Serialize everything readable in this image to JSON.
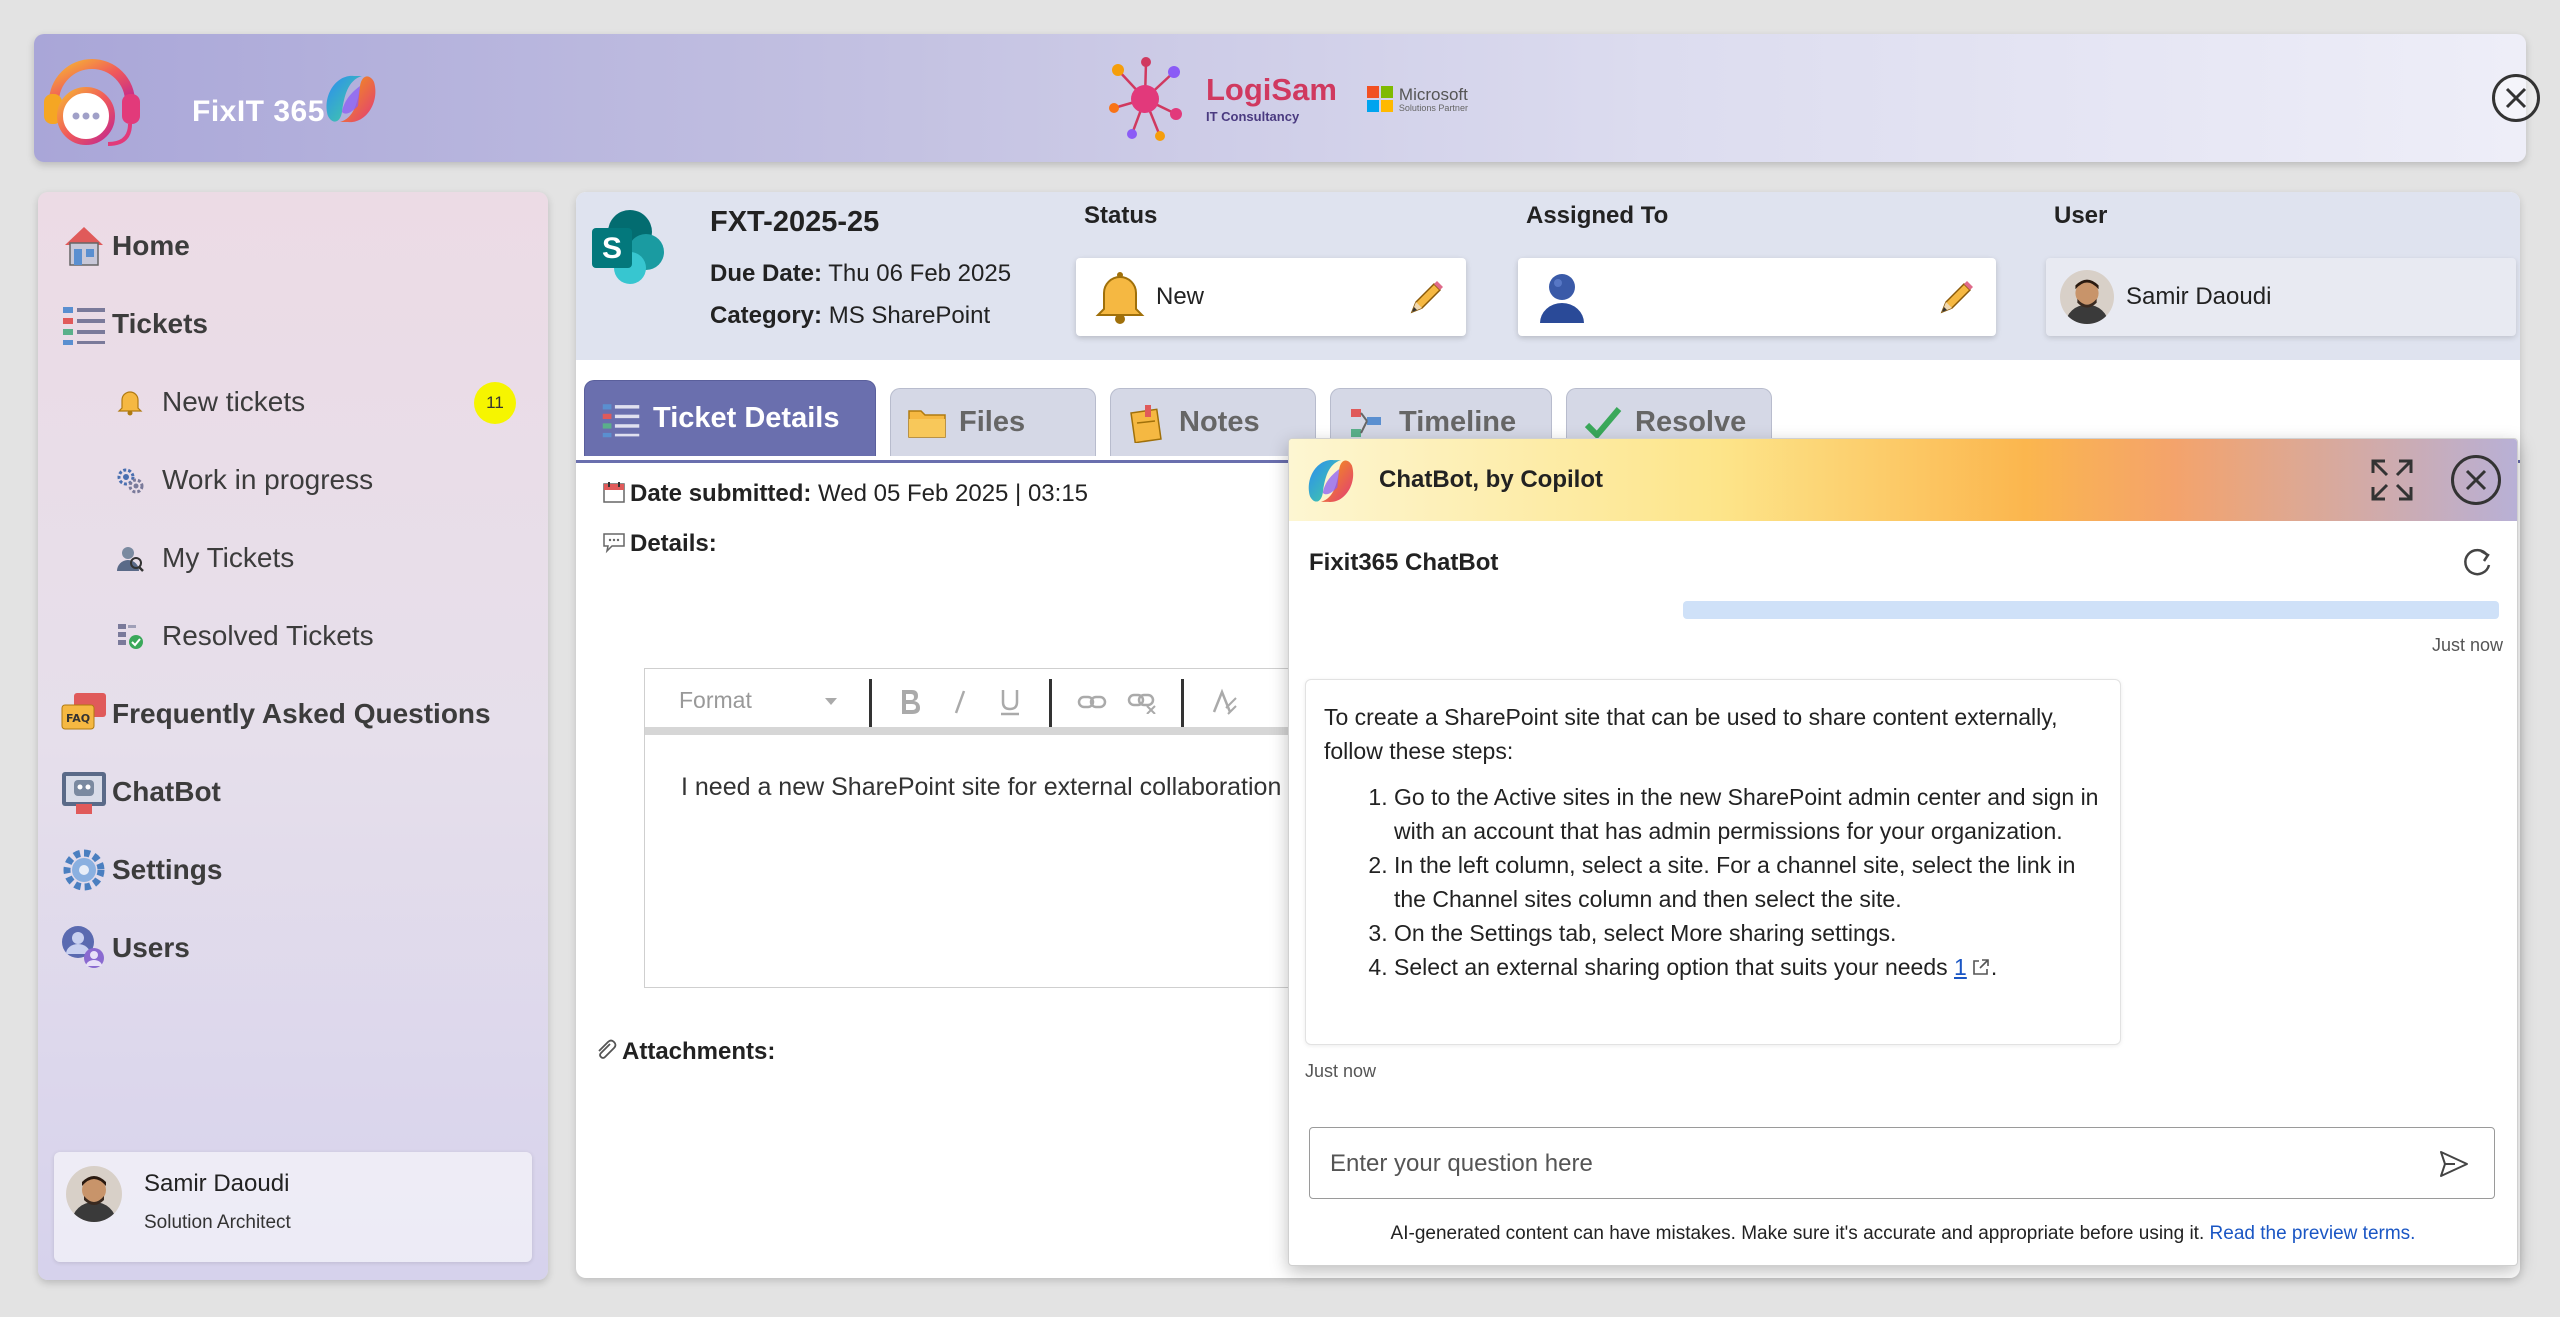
{
  "header": {
    "app_name": "FixIT 365",
    "partner_name": "LogiSam",
    "partner_sub": "IT Consultancy",
    "ms_line1": "Microsoft",
    "ms_line2": "Solutions Partner"
  },
  "sidebar": {
    "items": [
      {
        "label": "Home"
      },
      {
        "label": "Tickets"
      },
      {
        "label": "New tickets",
        "badge": "11"
      },
      {
        "label": "Work in progress"
      },
      {
        "label": "My Tickets"
      },
      {
        "label": "Resolved Tickets"
      },
      {
        "label": "Frequently Asked Questions"
      },
      {
        "label": "ChatBot"
      },
      {
        "label": "Settings"
      },
      {
        "label": "Users"
      }
    ],
    "user": {
      "name": "Samir Daoudi",
      "role": "Solution Architect"
    }
  },
  "ticket": {
    "id": "FXT-2025-25",
    "due_label": "Due Date:",
    "due_value": "Thu 06 Feb 2025",
    "category_label": "Category:",
    "category_value": "MS SharePoint",
    "status_label": "Status",
    "status_value": "New",
    "assigned_label": "Assigned To",
    "assigned_value": "",
    "user_label": "User",
    "user_value": "Samir Daoudi"
  },
  "tabs": [
    {
      "label": "Ticket Details"
    },
    {
      "label": "Files"
    },
    {
      "label": "Notes"
    },
    {
      "label": "Timeline"
    },
    {
      "label": "Resolve"
    }
  ],
  "details": {
    "date_label": "Date submitted:",
    "date_value": "Wed 05 Feb 2025 | 03:15",
    "details_label": "Details:",
    "format_label": "Format",
    "body_text": "I need a new SharePoint site for external collaboration",
    "attachments_label": "Attachments:"
  },
  "chat": {
    "title": "ChatBot, by Copilot",
    "bot_name": "Fixit365 ChatBot",
    "user_time": "Just now",
    "intro": "To create a SharePoint site that can be used to share content externally, follow these steps:",
    "steps": [
      "Go to the Active sites in the new SharePoint admin center and sign in with an account that has admin permissions for your organization.",
      "In the left column, select a site. For a channel site, select the link in the Channel sites column and then select the site.",
      "On the Settings tab, select More sharing settings.",
      "Select an external sharing option that suits your needs"
    ],
    "citation": "1",
    "bot_time": "Just now",
    "input_placeholder": "Enter your question here",
    "disclaimer": "AI-generated content can have mistakes. Make sure it's accurate and appropriate before using it.",
    "preview_link": "Read the preview terms."
  },
  "colors": {
    "tab_active": "#6a6fae",
    "badge": "#f6f500",
    "link": "#1a56c4"
  },
  "icons": [
    "headset-chat-icon",
    "copilot-icon",
    "logisam-icon",
    "microsoft-icon",
    "close-icon",
    "house-icon",
    "list-icon",
    "bell-icon",
    "gears-icon",
    "person-search-icon",
    "resolved-icon",
    "faq-icon",
    "robot-icon",
    "gear-icon",
    "users-icon",
    "sharepoint-icon",
    "pencil-icon",
    "person-icon",
    "calendar-icon",
    "speech-icon",
    "paperclip-icon",
    "folder-icon",
    "notes-icon",
    "timeline-icon",
    "check-icon",
    "expand-icon",
    "refresh-icon",
    "send-icon",
    "external-link-icon"
  ]
}
